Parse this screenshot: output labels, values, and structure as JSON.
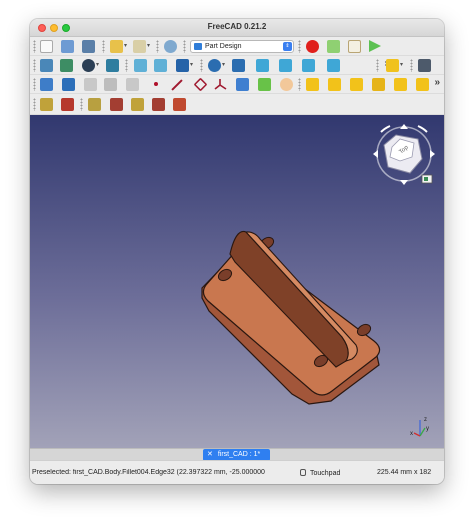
{
  "window": {
    "title": "FreeCAD 0.21.2"
  },
  "toolbar": {
    "workbench": {
      "selected": "Part Design"
    },
    "overflow_glyph": "»"
  },
  "document_tab": {
    "label": "first_CAD : 1*",
    "close_glyph": "✕"
  },
  "navigation_cube": {
    "face_label": "Top"
  },
  "axis_indicator": {
    "z": "z",
    "y": "y",
    "x": "x"
  },
  "statusbar": {
    "message": "Preselected: first_CAD.Body.Fillet004.Edge32 (22.397322 mm, -25.000000",
    "navigation_style": "Touchpad",
    "dimensions": "225.44 mm x 182"
  },
  "colors": {
    "part_face": "#c9774f",
    "part_side": "#a2563a",
    "part_edge": "#2a1710",
    "viewport_top": "#31386f",
    "viewport_bottom": "#a2a2b8",
    "accent": "#2f7ff0"
  },
  "icons": {
    "file": [
      "new-document-icon",
      "open-document-icon",
      "save-document-icon",
      "undo-icon",
      "redo-icon",
      "refresh-icon"
    ],
    "macro": [
      "record-macro-icon",
      "stop-macro-icon",
      "edit-macro-icon",
      "run-macro-icon"
    ],
    "view": [
      "fit-all-icon",
      "fit-selection-icon",
      "draw-style-icon",
      "sync-view-icon",
      "back-icon",
      "forward-icon",
      "std-views-icon",
      "measure-icon",
      "isometric-view-icon",
      "front-view-icon",
      "top-view-icon",
      "right-view-icon"
    ],
    "sketch": [
      "body-icon",
      "sketch-icon",
      "datum-point-icon",
      "datum-line-icon",
      "datum-plane-icon",
      "local-cs-icon",
      "shape-binder-icon",
      "clone-icon",
      "sub-shape-binder-icon",
      "whats-this-icon"
    ],
    "features": [
      "pad-icon",
      "revolution-icon",
      "loft-icon",
      "pipe-icon",
      "helix-icon",
      "pocket-icon",
      "hole-icon",
      "groove-icon",
      "subtractive-loft-icon",
      "subtractive-pipe-icon",
      "fillet-icon",
      "chamfer-icon",
      "draft-icon",
      "thickness-icon",
      "mirrored-icon",
      "linear-pattern-icon",
      "polar-pattern-icon",
      "multitransform-icon"
    ]
  }
}
